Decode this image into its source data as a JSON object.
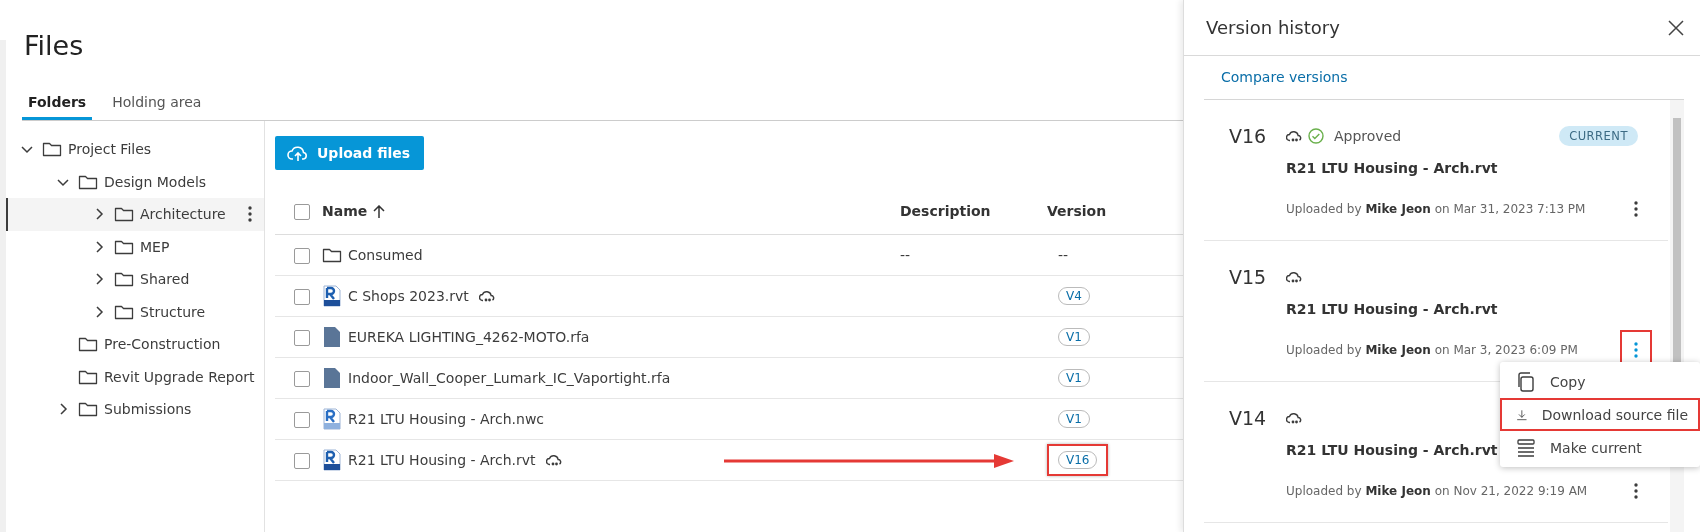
{
  "page": {
    "title": "Files"
  },
  "tabs": [
    {
      "label": "Folders",
      "selected": true
    },
    {
      "label": "Holding area",
      "selected": false
    }
  ],
  "tree": [
    {
      "label": "Project Files",
      "expandable": true,
      "expanded": true,
      "selected": false,
      "children": [
        {
          "label": "Design Models",
          "expandable": true,
          "expanded": true,
          "selected": false,
          "children": [
            {
              "label": "Architecture",
              "expandable": true,
              "expanded": false,
              "selected": true
            },
            {
              "label": "MEP",
              "expandable": true,
              "expanded": false,
              "selected": false
            },
            {
              "label": "Shared",
              "expandable": true,
              "expanded": false,
              "selected": false
            },
            {
              "label": "Structure",
              "expandable": true,
              "expanded": false,
              "selected": false
            }
          ]
        },
        {
          "label": "Pre-Construction",
          "expandable": false,
          "expanded": false,
          "selected": false
        },
        {
          "label": "Revit Upgrade Report",
          "expandable": false,
          "expanded": false,
          "selected": false
        },
        {
          "label": "Submissions",
          "expandable": true,
          "expanded": false,
          "selected": false
        }
      ]
    }
  ],
  "upload_button": "Upload files",
  "table": {
    "header_checked": false,
    "columns": [
      "Name",
      "Description",
      "Version"
    ],
    "rows": [
      {
        "kind": "folder",
        "name": "Consumed",
        "cloud": false,
        "checked": false,
        "description": "--",
        "version": "--",
        "highlighted": false,
        "arrow": false
      },
      {
        "kind": "rvt",
        "name": "C Shops 2023.rvt",
        "cloud": true,
        "checked": false,
        "version": "V4",
        "highlighted": false,
        "arrow": false
      },
      {
        "kind": "rfa",
        "name": "EUREKA LIGHTING_4262-MOTO.rfa",
        "cloud": false,
        "checked": false,
        "version": "V1",
        "highlighted": false,
        "arrow": false
      },
      {
        "kind": "rfa",
        "name": "Indoor_Wall_Cooper_Lumark_IC_Vaportight.rfa",
        "cloud": false,
        "checked": false,
        "version": "V1",
        "highlighted": false,
        "arrow": false
      },
      {
        "kind": "nwc",
        "name": "R21 LTU Housing - Arch.nwc",
        "cloud": false,
        "checked": false,
        "version": "V1",
        "highlighted": false,
        "arrow": false
      },
      {
        "kind": "rvt",
        "name": "R21 LTU Housing - Arch.rvt",
        "cloud": true,
        "checked": false,
        "version": "V16",
        "highlighted": true,
        "arrow": true
      }
    ]
  },
  "panel": {
    "title": "Version history",
    "link": "Compare versions",
    "versions": [
      {
        "version": "V16",
        "cloud": true,
        "status": "Approved",
        "badge": "CURRENT",
        "file": "R21 LTU Housing - Arch.rvt",
        "uploaded": "Uploaded by **Mike Jeon** on Mar 31, 2023 7:13 PM",
        "menu_highlighted": false
      },
      {
        "version": "V15",
        "cloud": true,
        "file": "R21 LTU Housing - Arch.rvt",
        "uploaded": "Uploaded by **Mike Jeon** on Mar 3, 2023 6:09 PM",
        "menu_highlighted": true
      },
      {
        "version": "V14",
        "cloud": true,
        "file": "R21 LTU Housing - Arch.rvt",
        "uploaded": "Uploaded by **Mike Jeon** on Nov 21, 2022 9:19 AM",
        "menu_highlighted": false
      }
    ],
    "context_menu": [
      {
        "kind": "copy",
        "label": "Copy",
        "highlighted": false
      },
      {
        "kind": "download",
        "label": "Download source file",
        "highlighted": true
      },
      {
        "kind": "make-current",
        "label": "Make current",
        "highlighted": false
      }
    ]
  }
}
